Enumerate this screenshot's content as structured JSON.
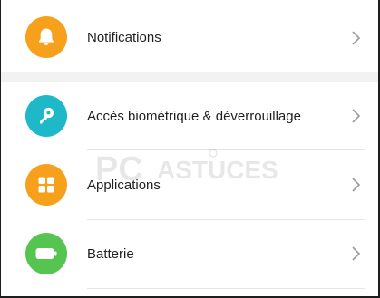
{
  "settings": {
    "items": [
      {
        "label": "Notifications",
        "icon": "bell-icon",
        "color": "#F7A01B"
      },
      {
        "label": "Accès biométrique & déverrouillage",
        "icon": "key-icon",
        "color": "#1FB8C9"
      },
      {
        "label": "Applications",
        "icon": "apps-grid-icon",
        "color": "#F7A01B"
      },
      {
        "label": "Batterie",
        "icon": "battery-icon",
        "color": "#56C451"
      }
    ]
  },
  "watermark": {
    "text_1": "PC",
    "text_2": "ASTUCES"
  }
}
